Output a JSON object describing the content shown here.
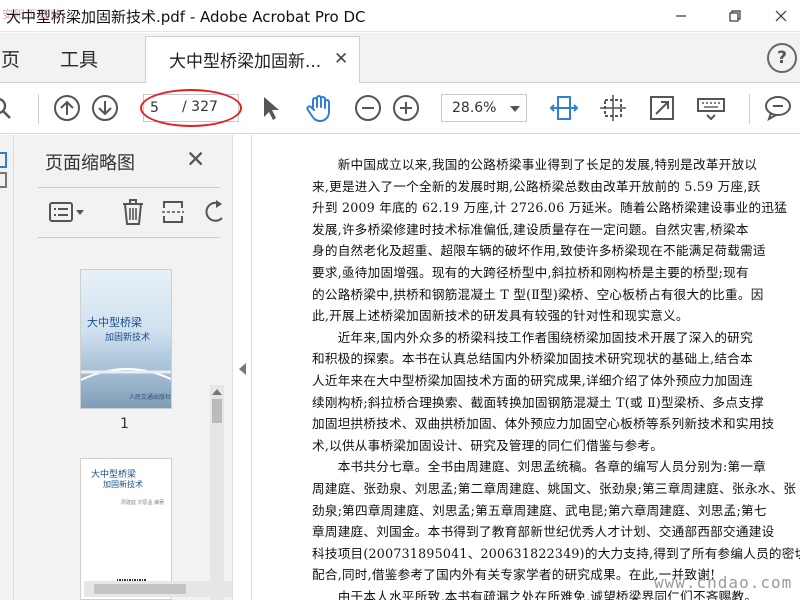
{
  "window": {
    "title": "大中型桥梁加固新技术.pdf - Adobe Acrobat Pro DC",
    "watermark": "安阳下载站"
  },
  "tabbar": {
    "home_label": "主页",
    "tools_label": "工具",
    "doc_tab_label": "大中型桥梁加固新...",
    "help_label": "?"
  },
  "toolbar": {
    "current_page": "5",
    "total_pages": "/ 327",
    "zoom": "28.6%"
  },
  "panel": {
    "title": "页面缩略图",
    "thumbnails": [
      {
        "label": "1",
        "title_line1": "大中型桥梁",
        "title_line2": "加固新技术",
        "publisher": "人民交通出版社"
      },
      {
        "title_line1": "大中型桥梁",
        "title_line2": "加固新技术",
        "credits": "周建庭 刘思孟 编著"
      }
    ]
  },
  "document": {
    "lines": [
      "　　新中国成立以来,我国的公路桥梁事业得到了长足的发展,特别是改革开放以",
      "来,更是进入了一个全新的发展时期,公路桥梁总数由改革开放前的 5.59 万座,跃",
      "升到 2009 年底的 62.19 万座,计 2726.06 万延米。随着公路桥梁建设事业的迅猛",
      "发展,许多桥梁修建时技术标准偏低,建设质量存在一定问题。自然灾害,桥梁本",
      "身的自然老化及超重、超限车辆的破坏作用,致使许多桥梁现在不能满足荷载需适",
      "要求,亟待加固增强。现有的大跨径桥型中,斜拉桥和刚构桥是主要的桥型;现有",
      "的公路桥梁中,拱桥和钢筋混凝土 T 型(Ⅱ型)梁桥、空心板桥占有很大的比重。因",
      "此,开展上述桥梁加固新技术的研发具有较强的针对性和现实意义。",
      "　　近年来,国内外众多的桥梁科技工作者围绕桥梁加固技术开展了深入的研究",
      "和积极的探索。本书在认真总结国内外桥梁加固技术研究现状的基础上,结合本",
      "人近年来在大中型桥梁加固技术方面的研究成果,详细介绍了体外预应力加固连",
      "续刚构桥;斜拉桥合理换索、截面转换加固钢筋混凝土 T(或 Ⅱ)型梁桥、多点支撑",
      "加固坦拱桥技术、双曲拱桥加固、体外预应力加固空心板桥等系列新技术和实用技",
      "术,以供从事桥梁加固设计、研究及管理的同仁们借鉴与参考。",
      "　　本书共分七章。全书由周建庭、刘思孟统稿。各章的编写人员分别为:第一章",
      "周建庭、张劲泉、刘思孟;第二章周建庭、姚国文、张劲泉;第三章周建庭、张永水、张",
      "劲泉;第四章周建庭、刘思孟;第五章周建庭、武电昆;第六章周建庭、刘思孟;第七",
      "章周建庭、刘国金。本书得到了教育部新世纪优秀人才计划、交通部西部交通建设",
      "科技项目(200731895041、200631822349)的大力支持,得到了所有参编人员的密切",
      "配合,同时,借鉴参考了国内外有关专家学者的研究成果。在此,一并致谢!",
      "　　由于本人水平所致,本书有疏漏之处在所难免,诚望桥梁界同仁们不吝赐教。"
    ],
    "site_watermark": "www.cndao.com"
  },
  "colors": {
    "accent_blue": "#2f7fd8",
    "highlight_red": "#e32020",
    "chrome_gray": "#f2f2f2"
  }
}
